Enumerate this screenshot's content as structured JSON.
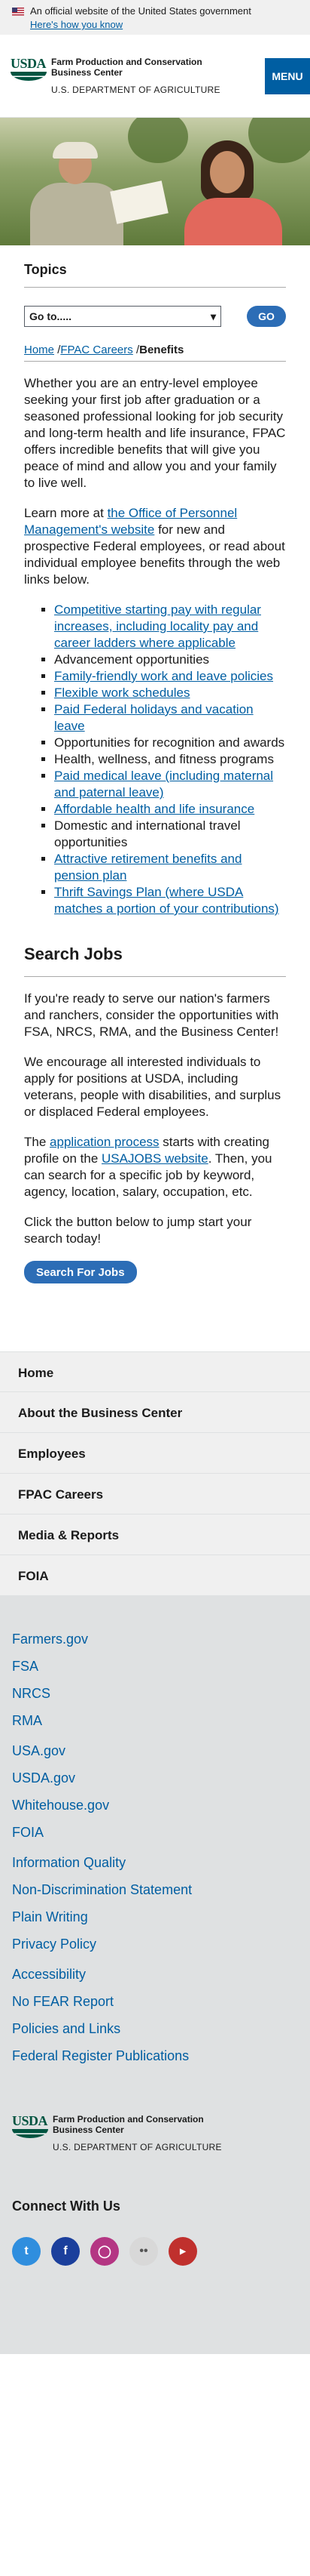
{
  "banner": {
    "text": "An official website of the United States government",
    "link": "Here's how you know"
  },
  "header": {
    "logo_text": "USDA",
    "agency_name": "Farm Production and Conservation Business Center",
    "dept": "U.S. DEPARTMENT OF AGRICULTURE",
    "menu_label": "MENU"
  },
  "topics": {
    "heading": "Topics",
    "select_value": "Go to.....",
    "go_label": "GO"
  },
  "breadcrumb": {
    "home": "Home",
    "careers": "FPAC Careers",
    "current": "Benefits",
    "sep": "/"
  },
  "intro": {
    "p1": "Whether you are an entry-level employee seeking your first job after graduation or a seasoned professional looking for job security and long-term health and life insurance, FPAC offers incredible benefits that will give you peace of mind and allow you and your family to live well.",
    "p2_before": "Learn more at ",
    "p2_link": "the Office of Personnel Management's website",
    "p2_after": " for new and prospective Federal employees, or read about individual employee benefits through the web links below."
  },
  "benefits": [
    {
      "text": "Competitive starting pay with regular increases, including locality pay and career ladders where applicable",
      "link": true
    },
    {
      "text": "Advancement opportunities",
      "link": false
    },
    {
      "text": "Family-friendly work and leave policies",
      "link": true
    },
    {
      "text": "Flexible work schedules",
      "link": true
    },
    {
      "text": "Paid Federal holidays and vacation leave",
      "link": true
    },
    {
      "text": "Opportunities for recognition and awards",
      "link": false
    },
    {
      "text": "Health, wellness, and fitness programs",
      "link": false
    },
    {
      "text": "Paid medical leave (including maternal and paternal leave)",
      "link": true
    },
    {
      "text": "Affordable health and life insurance",
      "link": true
    },
    {
      "text": "Domestic and international travel opportunities",
      "link": false
    },
    {
      "text": "Attractive retirement benefits and pension plan",
      "link": true
    },
    {
      "text": "Thrift Savings Plan (where USDA matches a portion of your contributions)",
      "link": true
    }
  ],
  "search_jobs": {
    "heading": "Search Jobs",
    "p1": "If you're ready to serve our nation's farmers and ranchers, consider the opportunities with FSA, NRCS, RMA, and the Business Center!",
    "p2": "We encourage all interested individuals to apply for positions at USDA, including veterans, people with disabilities, and surplus or displaced Federal employees.",
    "p3_a": "The ",
    "p3_link1": "application process",
    "p3_b": " starts with creating profile on the ",
    "p3_link2": "USAJOBS website",
    "p3_c": ". Then, you can search for a specific job by keyword, agency, location, salary, occupation, etc.",
    "p4": "Click the button below to jump start your search today!",
    "button": "Search For Jobs"
  },
  "footer_nav": [
    "Home",
    "About the Business Center",
    "Employees",
    "FPAC Careers",
    "Media & Reports",
    "FOIA"
  ],
  "footer_links": {
    "group1": [
      "Farmers.gov",
      "FSA",
      "NRCS",
      "RMA"
    ],
    "group2": [
      "USA.gov",
      "USDA.gov",
      "Whitehouse.gov",
      "FOIA"
    ],
    "group3": [
      "Information Quality",
      "Non-Discrimination Statement",
      "Plain Writing",
      "Privacy Policy"
    ],
    "group4": [
      "Accessibility",
      "No FEAR Report",
      "Policies and Links",
      "Federal Register Publications"
    ]
  },
  "connect": {
    "heading": "Connect With Us",
    "icons": [
      "twitter-icon",
      "facebook-icon",
      "instagram-icon",
      "flickr-icon",
      "youtube-icon"
    ]
  },
  "colors": {
    "primary": "#005ea2",
    "button": "#2c6db6",
    "usda_green": "#005440"
  }
}
